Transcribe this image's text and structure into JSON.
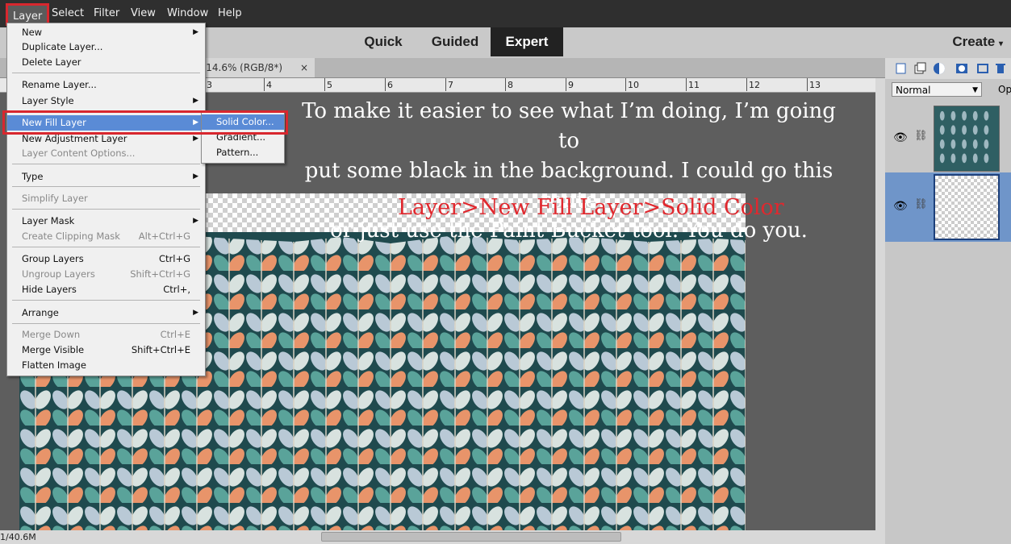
{
  "menubar": {
    "items": [
      "Layer",
      "Select",
      "Filter",
      "View",
      "Window",
      "Help"
    ]
  },
  "modes": {
    "items": [
      "Quick",
      "Guided",
      "Expert"
    ],
    "create": "Create"
  },
  "doc_tab": {
    "title": "g @ 14.6% (RGB/8*)",
    "close": "×"
  },
  "ruler": {
    "ticks": [
      "3",
      "4",
      "5",
      "6",
      "7",
      "8",
      "9",
      "10",
      "11",
      "12",
      "13"
    ]
  },
  "status": {
    "text": "1/40.6M"
  },
  "annotation": {
    "line1": "To make it easier to see what I’m doing, I’m going to",
    "line2": "put some black in the background. I could go this route",
    "line3": "or just use the Paint Bucket tool. You do you.",
    "path": "Layer>New Fill Layer>Solid Color",
    "path_color": "#e0282e"
  },
  "layers_panel": {
    "blend_mode": "Normal",
    "opacity_label": "Op"
  },
  "layer_menu": {
    "new": "New",
    "duplicate": "Duplicate Layer...",
    "delete": "Delete Layer",
    "rename": "Rename Layer...",
    "style": "Layer Style",
    "new_fill": "New Fill Layer",
    "new_adjustment": "New Adjustment Layer",
    "content_options": "Layer Content Options...",
    "type": "Type",
    "simplify": "Simplify Layer",
    "mask": "Layer Mask",
    "clipping": "Create Clipping Mask",
    "clipping_sc": "Alt+Ctrl+G",
    "group": "Group Layers",
    "group_sc": "Ctrl+G",
    "ungroup": "Ungroup Layers",
    "ungroup_sc": "Shift+Ctrl+G",
    "hide": "Hide Layers",
    "hide_sc": "Ctrl+,",
    "arrange": "Arrange",
    "merge_down": "Merge Down",
    "merge_down_sc": "Ctrl+E",
    "merge_visible": "Merge Visible",
    "merge_visible_sc": "Shift+Ctrl+E",
    "flatten": "Flatten Image"
  },
  "fill_submenu": {
    "solid": "Solid Color...",
    "gradient": "Gradient...",
    "pattern": "Pattern..."
  },
  "colors": {
    "highlight": "#5a8bd6",
    "callout_red": "#d8272e",
    "paper": "#1f4a4e"
  }
}
